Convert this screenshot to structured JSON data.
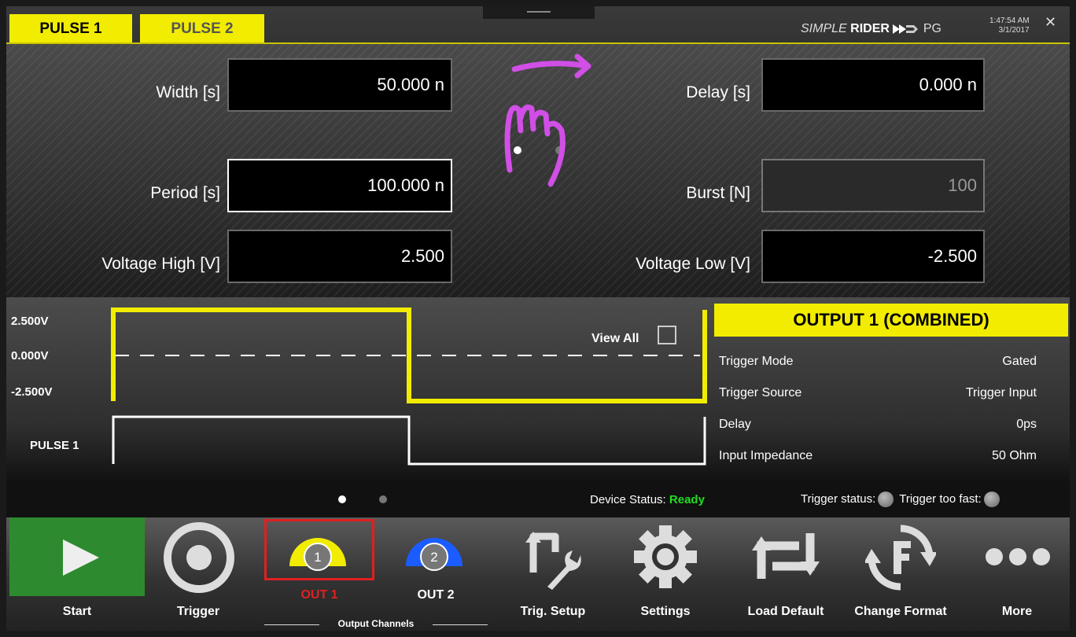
{
  "header": {
    "tabs": [
      {
        "label": "PULSE 1"
      },
      {
        "label": "PULSE 2"
      }
    ],
    "brand_italic": "SIMPLE",
    "brand_bold": "RIDER",
    "brand_suffix": "PG",
    "time": "1:47:54 AM",
    "date": "3/1/2017"
  },
  "params": {
    "width": {
      "label": "Width [s]",
      "value": "50.000 n"
    },
    "delay": {
      "label": "Delay [s]",
      "value": "0.000 n"
    },
    "period": {
      "label": "Period [s]",
      "value": "100.000 n"
    },
    "burst": {
      "label": "Burst [N]",
      "value": "100"
    },
    "vhigh": {
      "label": "Voltage High [V]",
      "value": "2.500"
    },
    "vlow": {
      "label": "Voltage Low [V]",
      "value": "-2.500"
    }
  },
  "waveform": {
    "levels": [
      "2.500V",
      "0.000V",
      "-2.500V"
    ],
    "pulse_label": "PULSE 1",
    "view_all": "View All",
    "output_panel": {
      "title": "OUTPUT 1 (COMBINED)",
      "rows": [
        {
          "label": "Trigger Mode",
          "value": "Gated"
        },
        {
          "label": "Trigger Source",
          "value": "Trigger Input"
        },
        {
          "label": "Delay",
          "value": "0ps"
        },
        {
          "label": "Input Impedance",
          "value": "50 Ohm"
        }
      ]
    }
  },
  "status": {
    "device_label": "Device Status:",
    "device_value": "Ready",
    "trigger_status": "Trigger status:",
    "trigger_fast": "Trigger too fast:"
  },
  "toolbar": {
    "start": "Start",
    "trigger": "Trigger",
    "out1": "OUT 1",
    "out1_num": "1",
    "out2": "OUT 2",
    "out2_num": "2",
    "output_channels": "Output Channels",
    "trig_setup": "Trig. Setup",
    "settings": "Settings",
    "load_default": "Load Default",
    "change_format": "Change Format",
    "more": "More"
  },
  "colors": {
    "accent_yellow": "#f2ec00",
    "ready_green": "#22dd22",
    "out1_red": "#e02020",
    "out2_blue": "#1a5cff",
    "gesture_purple": "#d14fe6"
  },
  "icons": [
    "gesture-swipe-icon",
    "play-icon",
    "record-icon",
    "wrench-icon",
    "gear-icon",
    "reload-icon",
    "format-icon",
    "more-icon",
    "close-icon"
  ]
}
